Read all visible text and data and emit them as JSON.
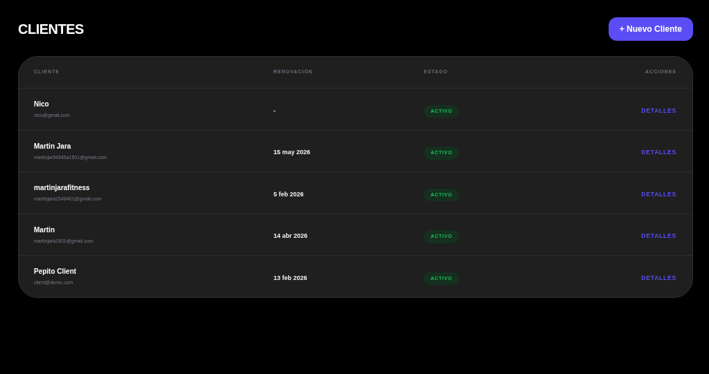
{
  "page_title": "CLIENTES",
  "new_button": "+ Nuevo Cliente",
  "table": {
    "columns": [
      "CLIENTE",
      "RENOVACIÓN",
      "ESTADO",
      "ACCIONES"
    ],
    "rows": [
      {
        "name": "Nico",
        "email": "nico@gmail.com",
        "renewal": "-",
        "status": "ACTIVO",
        "action": "DETALLES"
      },
      {
        "name": "Martin Jara",
        "email": "martinjar54545a1501@gmail.com",
        "renewal": "15 may 2026",
        "status": "ACTIVO",
        "action": "DETALLES"
      },
      {
        "name": "martinjarafitness",
        "email": "martinjara1548401@gmail.com",
        "renewal": "5 feb 2026",
        "status": "ACTIVO",
        "action": "DETALLES"
      },
      {
        "name": "Martin",
        "email": "martinjara1501@gmail.com",
        "renewal": "14 abr 2026",
        "status": "ACTIVO",
        "action": "DETALLES"
      },
      {
        "name": "Pepito Client",
        "email": "client@demo.com",
        "renewal": "13 feb 2026",
        "status": "ACTIVO",
        "action": "DETALLES"
      }
    ]
  }
}
